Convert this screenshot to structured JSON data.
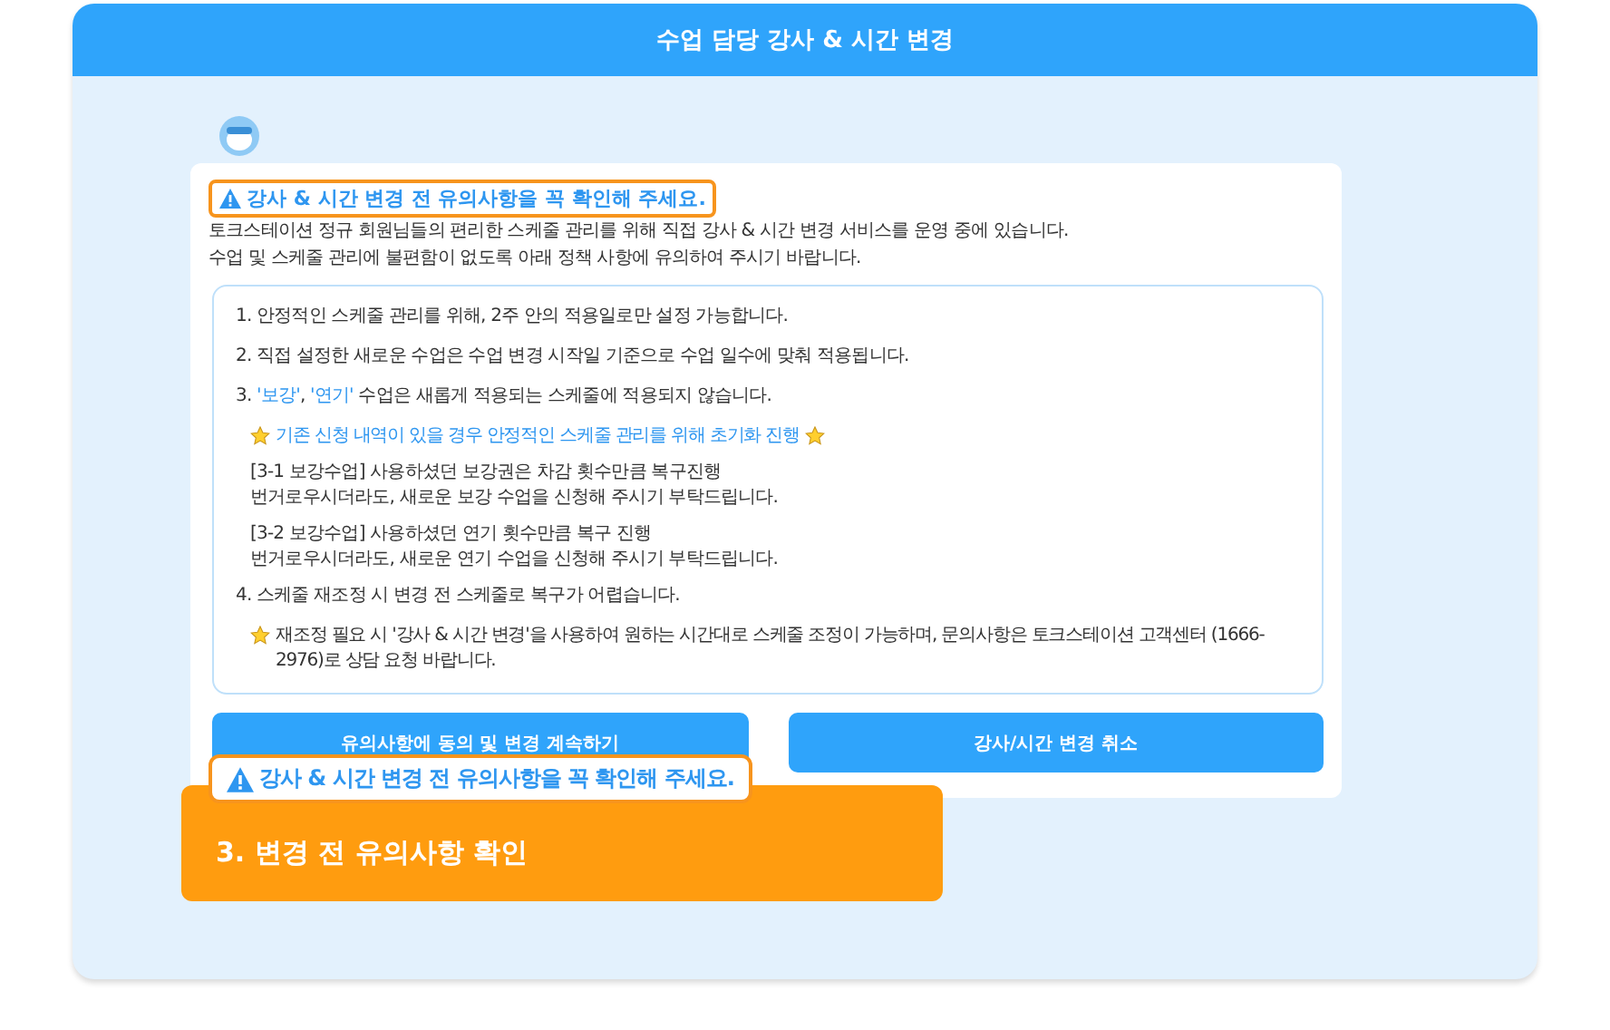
{
  "window": {
    "title": "수업 담당 강사 & 시간 변경"
  },
  "notice": {
    "heading": "강사 & 시간 변경 전 유의사항을 꼭 확인해 주세요.",
    "intro": [
      "토크스테이션 정규 회원님들의 편리한 스케줄 관리를 위해 직접 강사 & 시간 변경 서비스를 운영 중에 있습니다.",
      "수업 및 스케줄 관리에 불편함이 없도록 아래 정책 사항에 유의하여 주시기 바랍니다."
    ]
  },
  "rules": [
    {
      "kind": "item",
      "parts": [
        {
          "text": "1. 안정적인 스케줄 관리를 위해, 2주 안의 적용일로만 설정 가능합니다.",
          "highlight": false
        }
      ]
    },
    {
      "kind": "item",
      "parts": [
        {
          "text": "2. 직접 설정한 새로운 수업은 수업 변경 시작일 기준으로 수업 일수에 맞춰 적용됩니다.",
          "highlight": false
        }
      ]
    },
    {
      "kind": "item",
      "parts": [
        {
          "text": "3. ",
          "highlight": false
        },
        {
          "text": "'보강'",
          "highlight": true
        },
        {
          "text": ", ",
          "highlight": false
        },
        {
          "text": "'연기'",
          "highlight": true
        },
        {
          "text": " 수업은 새롭게 적용되는 스케줄에 적용되지 않습니다.",
          "highlight": false
        }
      ]
    },
    {
      "kind": "star_note",
      "text": "기존 신청 내역이 있을 경우 안정적인 스케줄 관리를 위해 초기화 진행",
      "highlight": true,
      "trailing_star": true
    },
    {
      "kind": "note",
      "lines": [
        "[3-1 보강수업] 사용하셨던 보강권은 차감 횟수만큼 복구진행",
        "번거로우시더라도, 새로운 보강 수업을 신청해 주시기 부탁드립니다."
      ]
    },
    {
      "kind": "note",
      "lines": [
        "[3-2 보강수업] 사용하셨던 연기 횟수만큼 복구 진행",
        "번거로우시더라도, 새로운 연기 수업을 신청해 주시기 부탁드립니다."
      ]
    },
    {
      "kind": "item",
      "parts": [
        {
          "text": "4. 스케줄 재조정 시 변경 전 스케줄로 복구가 어렵습니다.",
          "highlight": false
        }
      ]
    },
    {
      "kind": "star_note",
      "text": "재조정 필요 시 '강사 & 시간 변경'을 사용하여 원하는 시간대로 스케줄 조정이 가능하며, 문의사항은 토크스테이션 고객센터 (1666-2976)로 상담 요청 바랍니다.",
      "highlight": false,
      "trailing_star": false
    }
  ],
  "buttons": [
    "유의사항에 동의 및 변경 계속하기",
    "강사/시간 변경 취소"
  ],
  "callout": {
    "text": "강사 & 시간 변경 전 유의사항을 꼭 확인해 주세요.",
    "step": "3. 변경 전 유의사항 확인"
  }
}
